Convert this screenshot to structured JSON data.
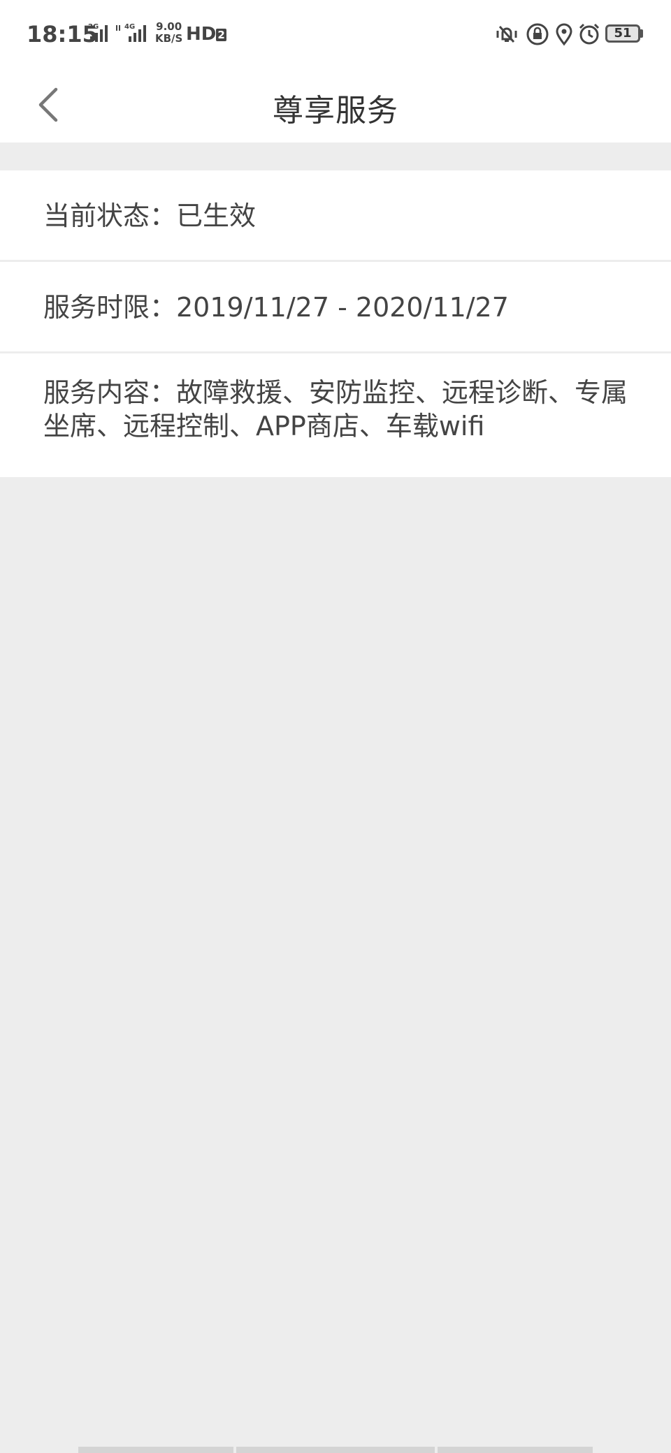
{
  "status_bar": {
    "time": "18:15",
    "net_speed_value": "9.00",
    "net_speed_unit": "KB/S",
    "sim1_label": "2G",
    "sim2_label": "4G",
    "hd_label": "HD",
    "hd_sub": "2",
    "battery_level": "51"
  },
  "header": {
    "title": "尊享服务"
  },
  "details": {
    "status_text": "当前状态：已生效",
    "period_text": "服务时限：2019/11/27 - 2020/11/27",
    "content_text": "服务内容：故障救援、安防监控、远程诊断、专属坐席、远程控制、APP商店、车载wifi"
  }
}
